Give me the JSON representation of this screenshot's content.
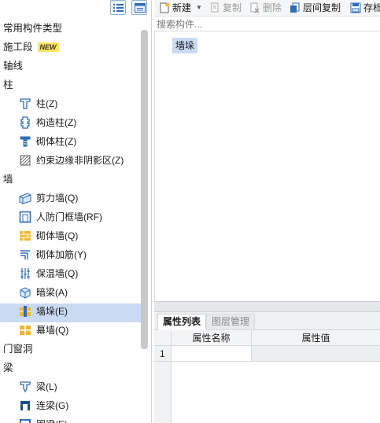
{
  "colors": {
    "selection": "#c9daf2",
    "accent_blue": "#2f6db5",
    "masonry_yellow": "#f3b731",
    "new_badge": "#ffe45c"
  },
  "view_buttons": [
    {
      "icon": "list-view-icon"
    },
    {
      "icon": "form-view-icon"
    }
  ],
  "tree": {
    "sections": [
      {
        "label": "常用构件类型"
      },
      {
        "label": "施工段",
        "badge": "NEW"
      },
      {
        "label": "轴线"
      },
      {
        "label": "柱",
        "items": [
          {
            "label": "柱(Z)",
            "icon": "column-icon"
          },
          {
            "label": "构造柱(Z)",
            "icon": "constructional-column-icon"
          },
          {
            "label": "砌体柱(Z)",
            "icon": "masonry-column-icon"
          },
          {
            "label": "约束边缘非阴影区(Z)",
            "icon": "hatched-zone-icon"
          }
        ]
      },
      {
        "label": "墙",
        "items": [
          {
            "label": "剪力墙(Q)",
            "icon": "shear-wall-icon"
          },
          {
            "label": "人防门框墙(RF)",
            "icon": "door-frame-wall-icon"
          },
          {
            "label": "砌体墙(Q)",
            "icon": "masonry-wall-icon"
          },
          {
            "label": "砌体加筋(Y)",
            "icon": "masonry-rebar-icon"
          },
          {
            "label": "保温墙(Q)",
            "icon": "insulation-wall-icon"
          },
          {
            "label": "暗梁(A)",
            "icon": "hidden-beam-icon"
          },
          {
            "label": "墙垛(E)",
            "icon": "wall-pier-icon",
            "selected": true
          },
          {
            "label": "幕墙(Q)",
            "icon": "curtain-wall-icon"
          }
        ]
      },
      {
        "label": "门窗洞"
      },
      {
        "label": "梁",
        "items": [
          {
            "label": "梁(L)",
            "icon": "beam-icon"
          },
          {
            "label": "连梁(G)",
            "icon": "coupling-beam-icon"
          },
          {
            "label": "圈梁(E)",
            "icon": "ring-beam-icon"
          }
        ]
      }
    ]
  },
  "toolbar": {
    "new_label": "新建",
    "copy_label": "复制",
    "delete_label": "删除",
    "floor_copy_label": "层间复制",
    "save_label": "存档"
  },
  "search": {
    "placeholder": "搜索构件..."
  },
  "component_list": [
    {
      "label": "墙垛",
      "selected": true
    }
  ],
  "properties": {
    "tabs": [
      {
        "label": "属性列表",
        "active": true
      },
      {
        "label": "图层管理",
        "active": false
      }
    ],
    "columns": [
      "属性名称",
      "属性值"
    ],
    "rows": [
      {
        "num": "1",
        "name": "",
        "value": ""
      }
    ]
  }
}
